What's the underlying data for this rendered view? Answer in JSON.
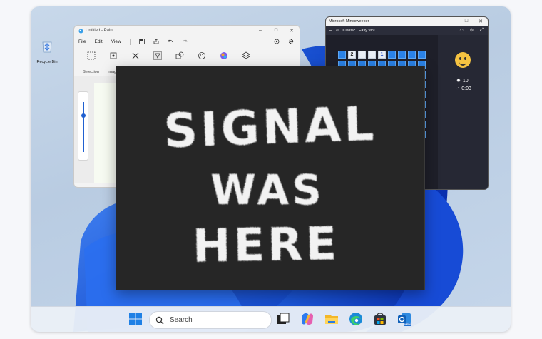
{
  "desktop": {
    "recycle_bin_label": "Recycle Bin"
  },
  "paint": {
    "title": "Untitled - Paint",
    "menus": [
      "File",
      "Edit",
      "View"
    ],
    "groups": [
      "Selection",
      "Image"
    ],
    "window_controls": [
      "–",
      "□",
      "✕"
    ]
  },
  "minesweeper": {
    "title": "Microsoft Minesweeper",
    "mode_label": "Classic | Easy 9x9",
    "mine_count": "10",
    "timer": "0:03",
    "window_controls": [
      "–",
      "□",
      "✕"
    ],
    "revealed": [
      {
        "row": 0,
        "col": 1,
        "text": "2"
      },
      {
        "row": 0,
        "col": 2,
        "text": ""
      },
      {
        "row": 0,
        "col": 3,
        "text": ""
      },
      {
        "row": 0,
        "col": 4,
        "text": "1"
      }
    ]
  },
  "sign": {
    "lines": [
      "SIGNAL",
      "WAS",
      "HERE"
    ],
    "colors": {
      "background": "#262626",
      "paint": "#f2f2f2"
    }
  },
  "taskbar": {
    "search_placeholder": "Search",
    "apps": [
      "start-icon",
      "task-view-icon",
      "copilot-icon",
      "file-explorer-icon",
      "edge-icon",
      "store-icon",
      "outlook-new-icon"
    ],
    "outlook_badge": "NEW"
  }
}
